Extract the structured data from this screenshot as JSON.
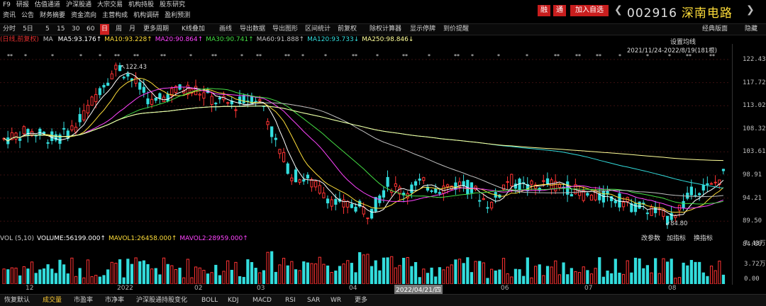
{
  "topnav": {
    "row1": [
      "F9",
      "研报",
      "估值通道",
      "沪深股通",
      "大宗交易",
      "机构持股",
      "股东研究"
    ],
    "row2": [
      "资讯",
      "公告",
      "财务摘要",
      "资金流向",
      "主营构成",
      "机构调研",
      "盈利预测"
    ],
    "badges": {
      "rong": "融",
      "tong": "通",
      "add": "加入自选"
    },
    "stock_code": "002916",
    "stock_name": "深南电路"
  },
  "toolbar": {
    "items": [
      "分时",
      "5日",
      "5",
      "15",
      "30",
      "60",
      "日",
      "周",
      "月",
      "更多周期",
      "K线叠加",
      "画线",
      "导出数据",
      "导出图形",
      "区间统计",
      "前复权",
      "除权计算器",
      "显示停牌",
      "到价提醒"
    ],
    "active": "日",
    "right": [
      "经典版面",
      "隐藏"
    ]
  },
  "indicators": {
    "prefix": "(日线,前复权)",
    "ma_label": "MA",
    "items": [
      {
        "text": "MA5:93.176↑",
        "color": "#ffffff"
      },
      {
        "text": "MA10:93.228↑",
        "color": "#ffde3a"
      },
      {
        "text": "MA20:90.864↑",
        "color": "#ff44ff"
      },
      {
        "text": "MA30:90.741↑",
        "color": "#44dd44"
      },
      {
        "text": "MA60:91.888↑",
        "color": "#c0c0c0"
      },
      {
        "text": "MA120:93.733↓",
        "color": "#33dddd"
      },
      {
        "text": "MA250:98.846↓",
        "color": "#ffff99"
      }
    ],
    "settings": "设置均线",
    "range": "2021/11/24-2022/8/19(181根)"
  },
  "price_axis": [
    "122.43",
    "117.72",
    "113.02",
    "108.32",
    "103.61",
    "98.91",
    "94.21",
    "89.50",
    "84.80"
  ],
  "chart_data": {
    "type": "candlestick",
    "high_label": "122.43",
    "low_label": "84.80",
    "ylim": [
      84.8,
      122.43
    ]
  },
  "volume": {
    "header": [
      {
        "text": "VOL (5,10)",
        "color": "#c8c8c8"
      },
      {
        "text": "VOLUME:56199.000↑",
        "color": "#ffffff"
      },
      {
        "text": "MAVOL1:26458.000↑",
        "color": "#ffde3a"
      },
      {
        "text": "MAVOL2:28959.000↑",
        "color": "#ff44ff"
      }
    ],
    "buttons": [
      "改参数",
      "加指标",
      "换指标"
    ],
    "axis": [
      "7.43万",
      "3.72万",
      "0.00"
    ]
  },
  "xaxis": {
    "labels": [
      "12",
      "2022",
      "02",
      "03",
      "04",
      "06",
      "07",
      "08"
    ],
    "cursor_date": "2022/04/21/四"
  },
  "bottomtabs": {
    "items": [
      "恢复默认",
      "成交量",
      "市盈率",
      "市净率",
      "沪深股通持股变化",
      "BOLL",
      "KDJ",
      "MACD",
      "RSI",
      "SAR",
      "WR",
      "更多"
    ],
    "active": "成交量"
  }
}
